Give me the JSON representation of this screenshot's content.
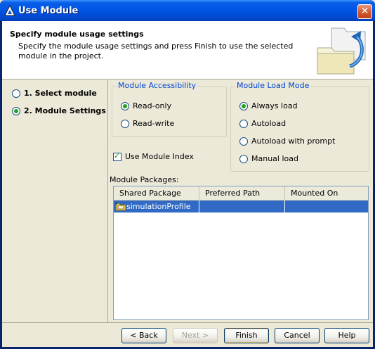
{
  "window": {
    "title": "Use Module",
    "close_glyph": "✕"
  },
  "header": {
    "title": "Specify module usage settings",
    "description": "Specify the module usage settings and press Finish to use the selected module in the project."
  },
  "steps": [
    {
      "label": "1. Select module",
      "selected": false
    },
    {
      "label": "2. Module Settings",
      "selected": true
    }
  ],
  "accessibility": {
    "legend": "Module Accessibility",
    "options": [
      {
        "label": "Read-only",
        "selected": true
      },
      {
        "label": "Read-write",
        "selected": false
      }
    ]
  },
  "load_mode": {
    "legend": "Module Load Mode",
    "options": [
      {
        "label": "Always load",
        "selected": true
      },
      {
        "label": "Autoload",
        "selected": false
      },
      {
        "label": "Autoload with prompt",
        "selected": false
      },
      {
        "label": "Manual load",
        "selected": false
      }
    ]
  },
  "use_index": {
    "label": "Use Module Index",
    "checked": true
  },
  "packages": {
    "label": "Module Packages:",
    "columns": [
      "Shared Package",
      "Preferred Path",
      "Mounted On"
    ],
    "rows": [
      {
        "shared_package": "simulationProfile",
        "preferred_path": "",
        "mounted_on": ""
      }
    ]
  },
  "buttons": {
    "back": "< Back",
    "next": "Next >",
    "finish": "Finish",
    "cancel": "Cancel",
    "help": "Help"
  },
  "colors": {
    "title_bar": "#0055E5",
    "selection": "#316AC5",
    "group_legend": "#0046D5"
  }
}
